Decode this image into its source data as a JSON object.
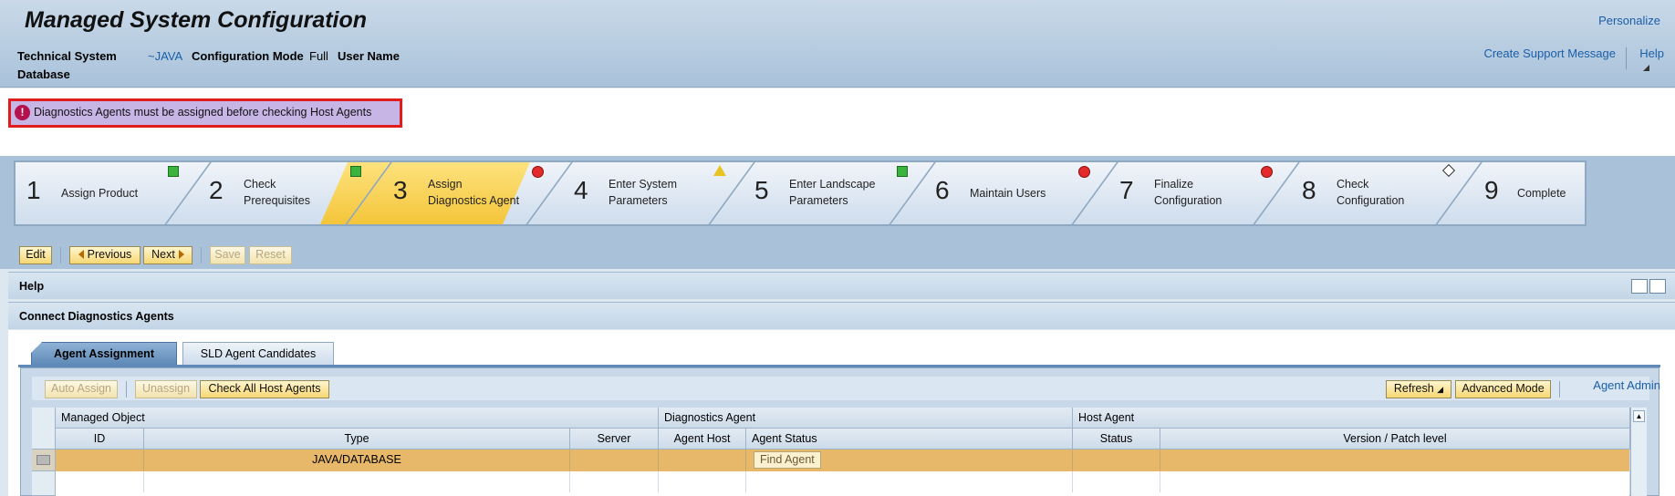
{
  "header": {
    "title": "Managed System Configuration",
    "personalize": "Personalize",
    "technical_system_label": "Technical System",
    "technical_system_value": "~JAVA",
    "config_mode_label": "Configuration Mode",
    "config_mode_value": "Full",
    "user_name_label": "User Name",
    "database_label": "Database",
    "create_support_message": "Create Support Message",
    "help": "Help"
  },
  "message": {
    "icon": "error-icon",
    "text": "Diagnostics Agents must be assigned before checking Host Agents"
  },
  "roadmap": {
    "steps": [
      {
        "num": "1",
        "label": "Assign Product",
        "status": "none"
      },
      {
        "num": "2",
        "label_line1": "Check",
        "label_line2": "Prerequisites",
        "status": "ok"
      },
      {
        "num": "3",
        "label_line1": "Assign",
        "label_line2": "Diagnostics Agent",
        "status": "ok",
        "active": true
      },
      {
        "num": "4",
        "label_line1": "Enter System",
        "label_line2": "Parameters",
        "status": "error"
      },
      {
        "num": "5",
        "label_line1": "Enter Landscape",
        "label_line2": "Parameters",
        "status": "warning"
      },
      {
        "num": "6",
        "label": "Maintain Users",
        "status": "ok"
      },
      {
        "num": "7",
        "label_line1": "Finalize",
        "label_line2": "Configuration",
        "status": "error"
      },
      {
        "num": "8",
        "label_line1": "Check",
        "label_line2": "Configuration",
        "status": "error"
      },
      {
        "num": "9",
        "label": "Complete",
        "status": "none"
      }
    ]
  },
  "toolbar": {
    "edit": "Edit",
    "previous": "Previous",
    "next": "Next",
    "save": "Save",
    "reset": "Reset"
  },
  "panels": {
    "help": "Help",
    "connect": "Connect Diagnostics Agents"
  },
  "tabs": {
    "agent_assignment": "Agent Assignment",
    "sld_candidates": "SLD Agent Candidates"
  },
  "grid_toolbar": {
    "auto_assign": "Auto Assign",
    "unassign": "Unassign",
    "check_all": "Check All Host Agents",
    "refresh": "Refresh",
    "advanced_mode": "Advanced Mode",
    "agent_admin": "Agent Admin"
  },
  "grid": {
    "group_headers": [
      "Managed Object",
      "Diagnostics Agent",
      "Host Agent"
    ],
    "columns": [
      "ID",
      "Type",
      "Server",
      "Agent Host",
      "Agent Status",
      "Status",
      "Version / Patch level"
    ],
    "rows": [
      {
        "id": "",
        "type": "JAVA/DATABASE",
        "server": "",
        "agent_host": "",
        "agent_status_button": "Find Agent",
        "status": "",
        "version": ""
      }
    ]
  },
  "colors": {
    "header_bg": "#a9c2da",
    "active_step": "#f4c53a",
    "selected_row": "#e8b86a",
    "error": "#e32b2b",
    "link": "#1a5fa8"
  }
}
